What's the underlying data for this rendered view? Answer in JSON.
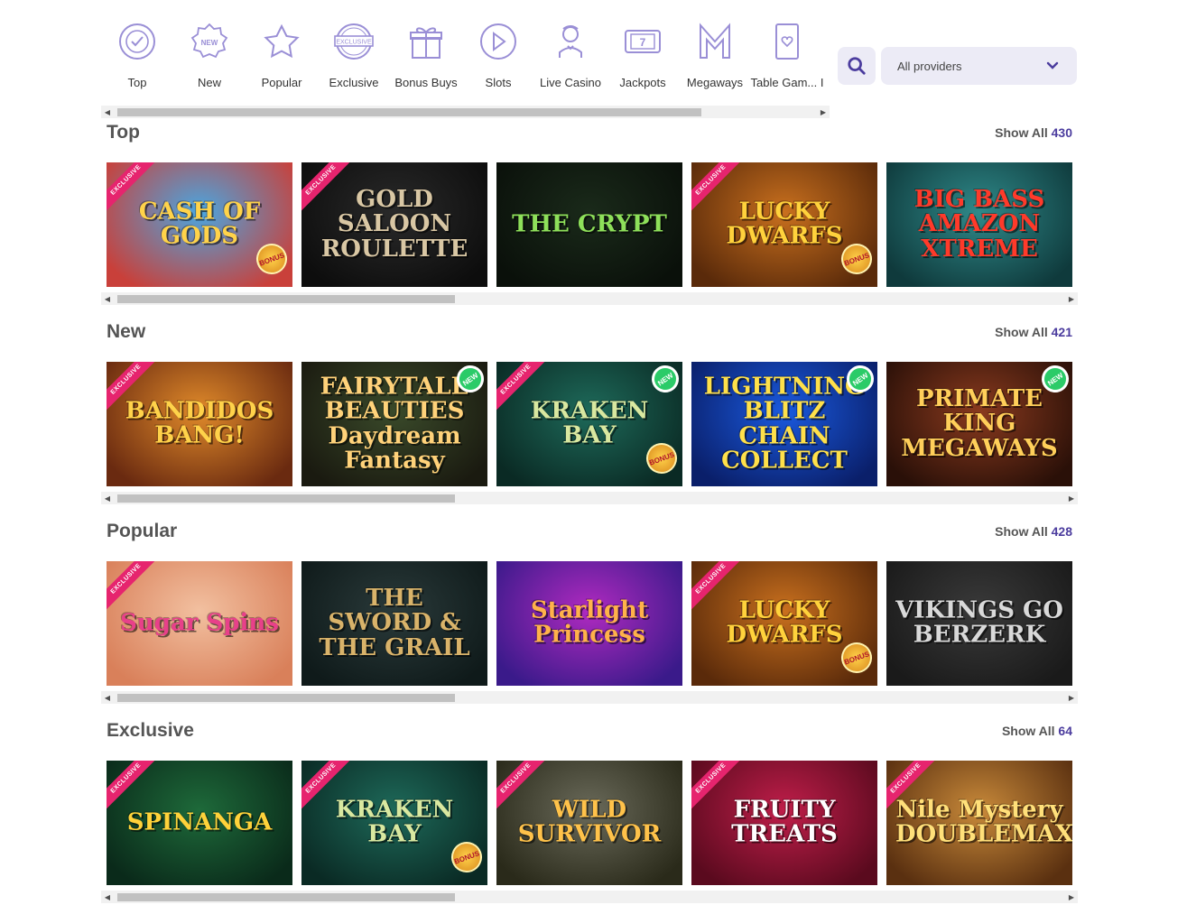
{
  "categories": [
    {
      "label": "Top",
      "icon": "top-badge-icon"
    },
    {
      "label": "New",
      "icon": "new-badge-icon"
    },
    {
      "label": "Popular",
      "icon": "star-icon"
    },
    {
      "label": "Exclusive",
      "icon": "exclusive-stamp-icon"
    },
    {
      "label": "Bonus Buys",
      "icon": "gift-icon"
    },
    {
      "label": "Slots",
      "icon": "play-icon"
    },
    {
      "label": "Live Casino",
      "icon": "dealer-icon"
    },
    {
      "label": "Jackpots",
      "icon": "slot-777-icon"
    },
    {
      "label": "Megaways",
      "icon": "megaways-m-icon"
    },
    {
      "label": "Table Gam... I",
      "icon": "playing-card-icon"
    }
  ],
  "search": {
    "icon": "search-icon"
  },
  "provider_filter": {
    "selected": "All providers",
    "icon": "chevron-down-icon"
  },
  "colors": {
    "accent": "#4b3c9e",
    "exclusive": "#e6246e",
    "new": "#2bcb68",
    "control_bg": "#ecebf6"
  },
  "sections": [
    {
      "title": "Top",
      "show_all_label": "Show All",
      "count": "430",
      "games": [
        {
          "title": "CASH OF GODS",
          "exclusive": true,
          "new": false,
          "bonus": true,
          "colors": [
            "#4aa6e0",
            "#c9403a"
          ],
          "text_color": "#ffd34a"
        },
        {
          "title": "GOLD SALOON ROULETTE",
          "exclusive": true,
          "new": false,
          "bonus": false,
          "colors": [
            "#2a2a2a",
            "#0d0d0d"
          ],
          "text_color": "#d9c7a4"
        },
        {
          "title": "THE CRYPT",
          "exclusive": false,
          "new": false,
          "bonus": false,
          "colors": [
            "#1a2a1a",
            "#0a100a"
          ],
          "text_color": "#8ee05a"
        },
        {
          "title": "LUCKY DWARFS",
          "exclusive": true,
          "new": false,
          "bonus": true,
          "colors": [
            "#c9701e",
            "#5a2a0a"
          ],
          "text_color": "#ffd23c"
        },
        {
          "title": "BIG BASS AMAZON XTREME",
          "exclusive": false,
          "new": false,
          "bonus": false,
          "colors": [
            "#2f8a8a",
            "#0f3a3c"
          ],
          "text_color": "#ff3a2a"
        }
      ]
    },
    {
      "title": "New",
      "show_all_label": "Show All",
      "count": "421",
      "games": [
        {
          "title": "BANDIDOS BANG!",
          "exclusive": true,
          "new": false,
          "bonus": false,
          "colors": [
            "#e08a2a",
            "#6a2a10"
          ],
          "text_color": "#ffd24a"
        },
        {
          "title": "FAIRYTALE BEAUTIES Daydream Fantasy",
          "exclusive": false,
          "new": true,
          "bonus": false,
          "colors": [
            "#3a4a2a",
            "#1a1a10"
          ],
          "text_color": "#ffd27a"
        },
        {
          "title": "KRAKEN BAY",
          "exclusive": true,
          "new": true,
          "bonus": true,
          "colors": [
            "#1e6a5a",
            "#0a2a24"
          ],
          "text_color": "#d9e8a0"
        },
        {
          "title": "LIGHTNING BLITZ CHAIN COLLECT",
          "exclusive": false,
          "new": true,
          "bonus": false,
          "colors": [
            "#1a5adf",
            "#0a1f6a"
          ],
          "text_color": "#ffe04a"
        },
        {
          "title": "PRIMATE KING MEGAWAYS",
          "exclusive": false,
          "new": true,
          "bonus": false,
          "colors": [
            "#8a3a1e",
            "#2a1008"
          ],
          "text_color": "#ffcf5a"
        }
      ]
    },
    {
      "title": "Popular",
      "show_all_label": "Show All",
      "count": "428",
      "games": [
        {
          "title": "Sugar Spins",
          "exclusive": true,
          "new": false,
          "bonus": false,
          "colors": [
            "#f2c0a0",
            "#d9805a"
          ],
          "text_color": "#e8408a"
        },
        {
          "title": "THE SWORD & THE GRAIL",
          "exclusive": false,
          "new": false,
          "bonus": false,
          "colors": [
            "#2a3a3a",
            "#0f1a1a"
          ],
          "text_color": "#d9b36a"
        },
        {
          "title": "Starlight Princess",
          "exclusive": false,
          "new": false,
          "bonus": false,
          "colors": [
            "#b02ac0",
            "#3a1a8a"
          ],
          "text_color": "#ffb24a"
        },
        {
          "title": "LUCKY DWARFS",
          "exclusive": true,
          "new": false,
          "bonus": true,
          "colors": [
            "#c9701e",
            "#5a2a0a"
          ],
          "text_color": "#ffd23c"
        },
        {
          "title": "VIKINGS GO BERZERK",
          "exclusive": false,
          "new": false,
          "bonus": false,
          "colors": [
            "#3a3a3a",
            "#1a1a1a"
          ],
          "text_color": "#d9d9d9"
        }
      ]
    },
    {
      "title": "Exclusive",
      "show_all_label": "Show All",
      "count": "64",
      "games": [
        {
          "title": "SPINANGA",
          "exclusive": true,
          "new": false,
          "bonus": false,
          "colors": [
            "#1e6a3a",
            "#0a2a1a"
          ],
          "text_color": "#ffd23a"
        },
        {
          "title": "KRAKEN BAY",
          "exclusive": true,
          "new": false,
          "bonus": true,
          "colors": [
            "#1e6a5a",
            "#0a2a24"
          ],
          "text_color": "#d9e8a0"
        },
        {
          "title": "WILD SURVIVOR",
          "exclusive": true,
          "new": false,
          "bonus": false,
          "colors": [
            "#6a6a5a",
            "#2a2a1a"
          ],
          "text_color": "#ffc24a"
        },
        {
          "title": "FRUITY TREATS",
          "exclusive": true,
          "new": false,
          "bonus": false,
          "colors": [
            "#c01e4a",
            "#5a0a1e"
          ],
          "text_color": "#ffffff"
        },
        {
          "title": "Nile Mystery DOUBLEMAX",
          "exclusive": true,
          "new": false,
          "bonus": false,
          "colors": [
            "#c98a3a",
            "#5a3010"
          ],
          "text_color": "#ffe07a"
        }
      ]
    }
  ],
  "badges": {
    "exclusive_label": "EXCLUSIVE",
    "new_label": "NEW",
    "bonus_label": "BONUS"
  }
}
